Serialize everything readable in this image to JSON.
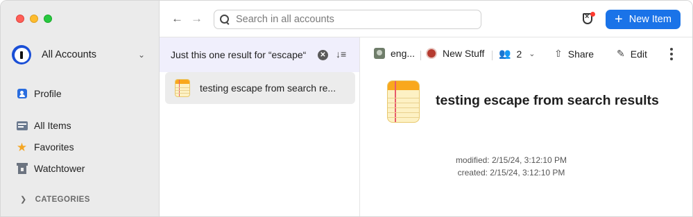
{
  "sidebar": {
    "account_name": "All Accounts",
    "items": [
      {
        "label": "Profile",
        "icon": "profile-icon"
      },
      {
        "label": "All Items",
        "icon": "all-items-icon"
      },
      {
        "label": "Favorites",
        "icon": "star-icon"
      },
      {
        "label": "Watchtower",
        "icon": "watchtower-icon"
      }
    ],
    "categories_label": "CATEGORIES"
  },
  "toolbar": {
    "search_placeholder": "Search in all accounts",
    "new_item_label": "New Item"
  },
  "list": {
    "header_text": "Just this one result for “escape“",
    "rows": [
      {
        "title": "testing escape from search re..."
      }
    ]
  },
  "detail": {
    "vault_name": "eng...",
    "collection_name": "New Stuff",
    "people_count": "2",
    "share_label": "Share",
    "edit_label": "Edit",
    "title": "testing escape from search results",
    "modified": "modified: 2/15/24, 3:12:10 PM",
    "created": "created: 2/15/24, 3:12:10 PM"
  },
  "colors": {
    "accent": "#1a73e8",
    "sidebar_bg": "#ebebeb",
    "list_header_bg": "#f0effc",
    "note_yellow": "#f9a81d"
  }
}
